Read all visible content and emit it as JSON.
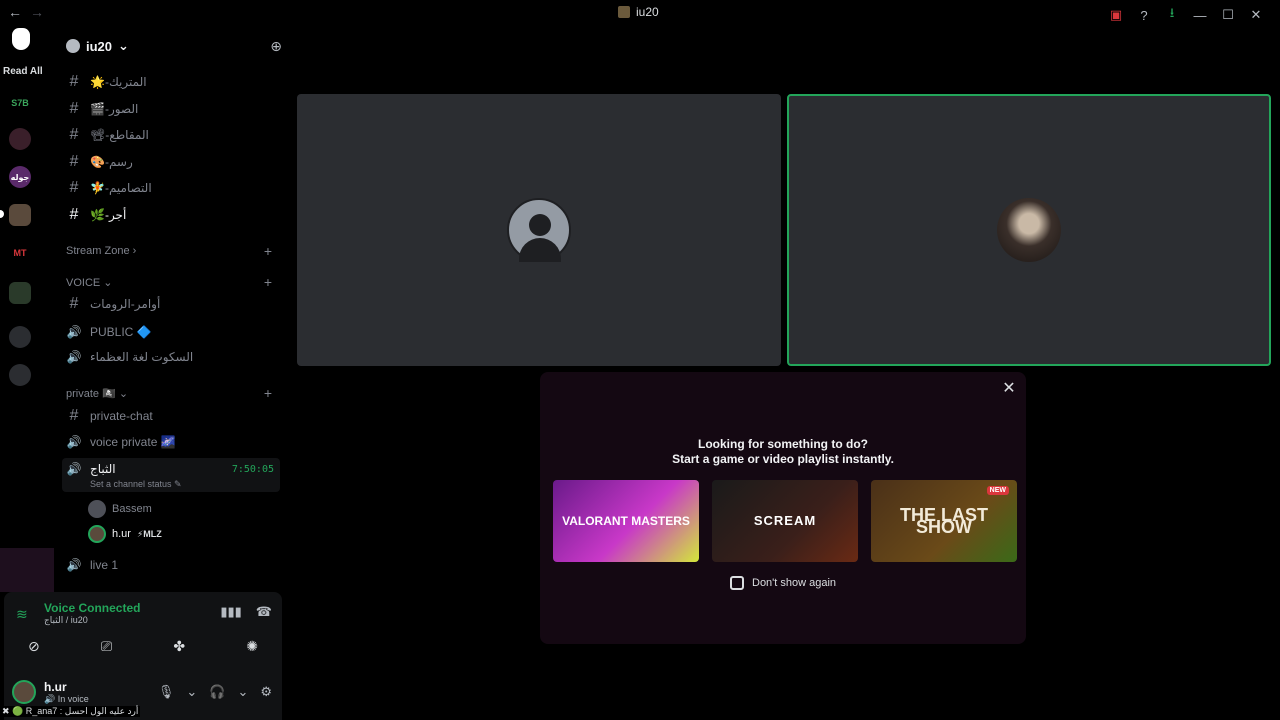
{
  "titlebar": {
    "back": "←",
    "forward": "→",
    "title": "iu20",
    "icons": [
      "inbox-icon",
      "help-icon",
      "download-icon",
      "minimize-icon",
      "maximize-icon",
      "close-icon"
    ],
    "glyphs": [
      "▣",
      "?",
      "⭳",
      "—",
      "☐",
      "✕"
    ]
  },
  "rail": {
    "read_all": "Read All",
    "servers": [
      "S7B",
      "",
      "جوله",
      "",
      "MT",
      "",
      "",
      ""
    ]
  },
  "sidebar": {
    "server_name": "iu20",
    "chevron": "⌄",
    "add_member_icon": "👤+",
    "text_channels": [
      {
        "label": "🌟-المتريك"
      },
      {
        "label": "🎬-الصور"
      },
      {
        "label": "📽-المقاطع"
      },
      {
        "label": "🎨-رسم"
      },
      {
        "label": "🧚-التصاميم"
      },
      {
        "label": "🌿-أجر"
      }
    ],
    "category_stream": "Stream Zone ›",
    "category_voice": "VOICE ⌄",
    "voice_channels": [
      {
        "label": "أوامر-الرومات",
        "icon": "#"
      },
      {
        "label": "PUBLIC 🔷",
        "icon": "🔊"
      },
      {
        "label": "السكوت لغة العظماء",
        "icon": "🔊"
      }
    ],
    "category_private": "private 🏴‍☠️ ⌄",
    "private_channels": [
      {
        "label": "private-chat",
        "icon": "#"
      },
      {
        "label": "voice private 🌌",
        "icon": "🔊"
      }
    ],
    "live_channel": {
      "label": "الثباج",
      "time": "7:50:05",
      "status": "Set a channel status ✎"
    },
    "voice_users": [
      {
        "name": "Bassem"
      },
      {
        "name": "h.ur",
        "tag": "⚡MLZ"
      }
    ],
    "live1": "live 1",
    "plus": "+"
  },
  "voice_panel": {
    "title": "Voice Connected",
    "subtitle": "الثباج / iu20",
    "signal": "📶",
    "noise": "▮▮▮",
    "disconnect": "☎",
    "actions": [
      "⊘",
      "⎚",
      "✤",
      "✺"
    ]
  },
  "user_panel": {
    "name": "h.ur",
    "status": "🔊 In voice",
    "controls": [
      "🎙",
      "⌄",
      "🎧",
      "⌄",
      "⚙"
    ]
  },
  "ticker": "✖ 🟢 R_ana7 : أرد عليه الول احسل",
  "popup": {
    "close": "✕",
    "title_line1": "Looking for something to do?",
    "title_line2": "Start a game or video playlist instantly.",
    "cards": [
      {
        "label": "VALORANT MASTERS"
      },
      {
        "label": "SCREAM"
      },
      {
        "label": "THE LAST SHOW",
        "badge": "NEW"
      }
    ],
    "dont_show": "Don't show again"
  }
}
